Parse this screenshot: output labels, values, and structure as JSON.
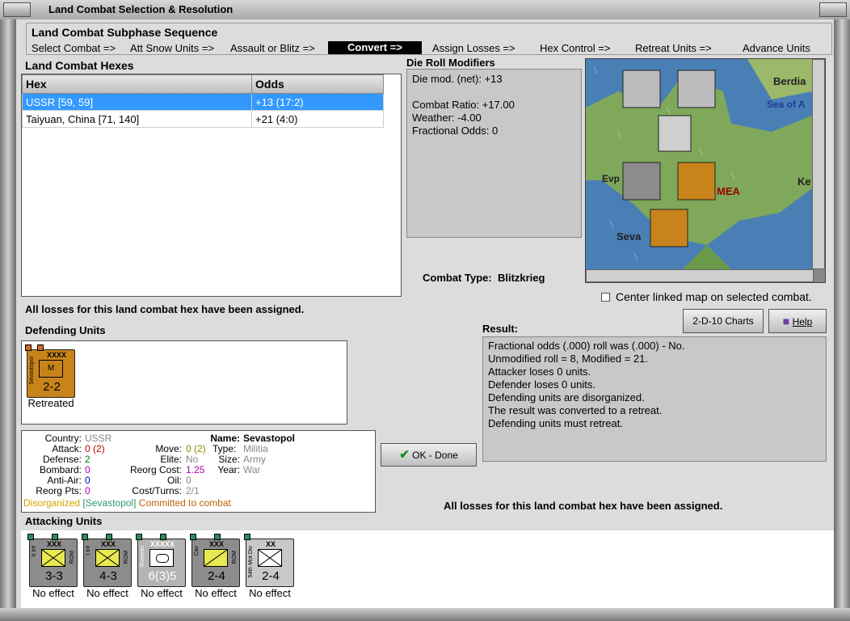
{
  "window": {
    "title": "Land Combat Selection & Resolution"
  },
  "subphase": {
    "header": "Land Combat Subphase Sequence",
    "steps": [
      "Select Combat =>",
      "Att Snow Units =>",
      "Assault or Blitz =>",
      "Convert =>",
      "Assign Losses =>",
      "Hex Control =>",
      "Retreat Units =>",
      "Advance Units"
    ],
    "current_index": 3
  },
  "hexes": {
    "header": "Land Combat Hexes",
    "columns": [
      "Hex",
      "Odds"
    ],
    "rows": [
      {
        "hex": "USSR [59, 59]",
        "odds": "+13 (17:2)",
        "selected": true
      },
      {
        "hex": "Taiyuan, China [71, 140]",
        "odds": "+21 (4:0)",
        "selected": false
      }
    ],
    "status": "All losses for this land combat hex have been assigned."
  },
  "die_roll": {
    "header": "Die Roll Modifiers",
    "lines": [
      "Die mod. (net): +13",
      "",
      "Combat Ratio: +17.00",
      "Weather: -4.00",
      "Fractional Odds: 0"
    ]
  },
  "combat_type": {
    "label": "Combat Type:",
    "value": "Blitzkrieg"
  },
  "map": {
    "labels": [
      "Berdia",
      "Sea of A",
      "Evp",
      "MEA",
      "Ke",
      "Seva"
    ],
    "center_checkbox_label": "Center linked map on selected combat.",
    "center_checked": false
  },
  "buttons": {
    "charts": "2-D-10 Charts",
    "help": "Help",
    "ok": "OK - Done"
  },
  "defending": {
    "header": "Defending Units",
    "units": [
      {
        "size": "XXXX",
        "name": "Sevastopol",
        "value": "2-2",
        "symbol": "M",
        "caption": "Retreated"
      }
    ]
  },
  "unit_info": {
    "country_label": "Country:",
    "country": "USSR",
    "name_label": "Name:",
    "name": "Sevastopol",
    "attack_label": "Attack:",
    "attack": "0 (2)",
    "defense_label": "Defense:",
    "defense": "2",
    "bombard_label": "Bombard:",
    "bombard": "0",
    "antiair_label": "Anti-Air:",
    "antiair": "0",
    "reorgpts_label": "Reorg Pts:",
    "reorgpts": "0",
    "move_label": "Move:",
    "move": "0 (2)",
    "elite_label": "Elite:",
    "elite": "No",
    "reorgcost_label": "Reorg Cost:",
    "reorgcost": "1.25",
    "oil_label": "Oil:",
    "oil": "0",
    "costturns_label": "Cost/Turns:",
    "costturns": "2/1",
    "type_label": "Type:",
    "type": "Militia",
    "size_label": "Size:",
    "size": "Army",
    "year_label": "Year:",
    "year": "War",
    "status_disorg": "Disorganized",
    "status_name": "[Sevastopol]",
    "status_commit": "Committed to combat"
  },
  "result": {
    "header": "Result:",
    "lines": [
      "Fractional odds (.000) roll was (.000)  - No.",
      "Unmodified roll = 8, Modified = 21.",
      "Attacker loses 0 units.",
      "Defender loses 0 units.",
      "Defending units are disorganized.",
      "The result was converted to a retreat.",
      "Defending units must retreat."
    ],
    "status": "All losses for this land combat hex have been assigned."
  },
  "attacking": {
    "header": "Attacking Units",
    "units": [
      {
        "size": "XXX",
        "side": "II Inf",
        "nation": "ROM",
        "value": "3-3",
        "caption": "No effect"
      },
      {
        "size": "XXX",
        "side": "I Inf",
        "nation": "ROM",
        "value": "4-3",
        "caption": "No effect"
      },
      {
        "size": "XXXXX",
        "side": "Rommel",
        "nation": "",
        "value": "6(3)5",
        "caption": "No effect"
      },
      {
        "size": "XXX",
        "side": "Cav",
        "nation": "ROM",
        "value": "2-4",
        "caption": "No effect"
      },
      {
        "size": "XX",
        "side": "54th Mot Div",
        "nation": "",
        "value": "2-4",
        "caption": "No effect"
      }
    ]
  },
  "colors": {
    "selection": "#3399ff",
    "current_step_bg": "#000000",
    "soviet_counter": "#c8841a",
    "romanian_counter": "#8c8c8c",
    "german_counter": "#b4b4b4",
    "disorganized": "#d4a000",
    "committed": "#c06000",
    "sea": "#4a7fb5",
    "land": "#7fa85a"
  }
}
